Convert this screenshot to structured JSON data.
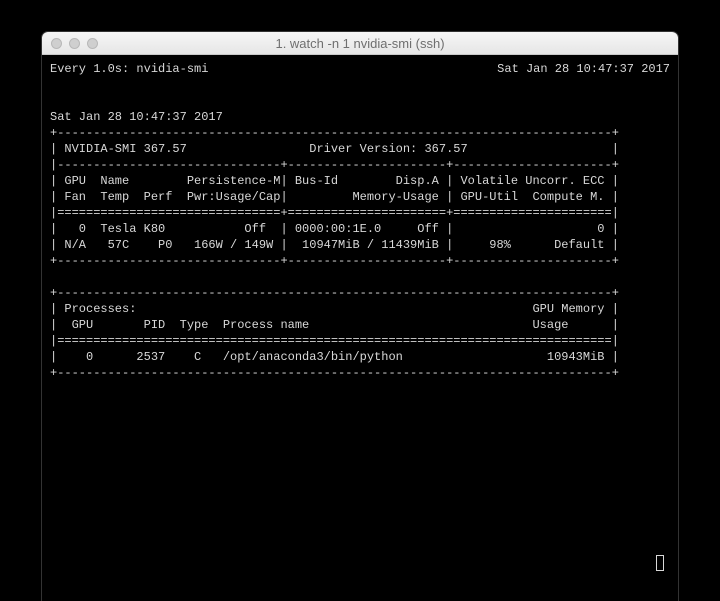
{
  "window": {
    "title": "1. watch -n 1 nvidia-smi (ssh)"
  },
  "watch": {
    "left": "Every 1.0s: nvidia-smi",
    "right": "Sat Jan 28 10:47:37 2017"
  },
  "smi": {
    "timestamp": "Sat Jan 28 10:47:37 2017",
    "version_line": "| NVIDIA-SMI 367.57                 Driver Version: 367.57                    |",
    "header1": "| GPU  Name        Persistence-M| Bus-Id        Disp.A | Volatile Uncorr. ECC |",
    "header2": "| Fan  Temp  Perf  Pwr:Usage/Cap|         Memory-Usage | GPU-Util  Compute M. |",
    "gpu_line1": "|   0  Tesla K80           Off  | 0000:00:1E.0     Off |                    0 |",
    "gpu_line2": "| N/A   57C    P0   166W / 149W |  10947MiB / 11439MiB |     98%      Default |",
    "proc_hdr1": "| Processes:                                                       GPU Memory |",
    "proc_hdr2": "|  GPU       PID  Type  Process name                               Usage      |",
    "proc_line": "|    0      2537    C   /opt/anaconda3/bin/python                    10943MiB |",
    "rule_plus": "+-----------------------------------------------------------------------------+",
    "rule_split3": "|-------------------------------+----------------------+----------------------+",
    "rule_eq3": "|===============================+======================+======================|",
    "rule_bot3": "+-------------------------------+----------------------+----------------------+",
    "rule_eq1": "|=============================================================================|"
  },
  "gpu": {
    "index": 0,
    "name": "Tesla K80",
    "persistence": "Off",
    "bus_id": "0000:00:1E.0",
    "disp_a": "Off",
    "ecc": 0,
    "fan": "N/A",
    "temp_c": 57,
    "perf": "P0",
    "power_usage_w": 166,
    "power_cap_w": 149,
    "mem_used_mib": 10947,
    "mem_total_mib": 11439,
    "gpu_util_pct": 98,
    "compute_mode": "Default"
  },
  "process": {
    "gpu": 0,
    "pid": 2537,
    "type": "C",
    "name": "/opt/anaconda3/bin/python",
    "mem_mib": 10943
  },
  "driver": {
    "smi_version": "367.57",
    "driver_version": "367.57"
  }
}
